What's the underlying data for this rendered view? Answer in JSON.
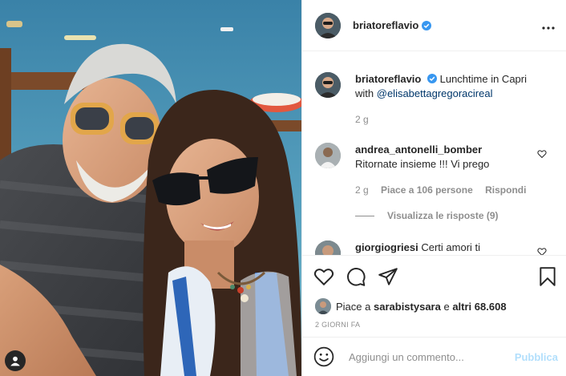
{
  "post": {
    "username": "briatoreflavio",
    "more_icon": "more-horizontal-icon",
    "caption_text": "Lunchtime in Capri",
    "caption_with": "with",
    "caption_mention": "@elisabettagregoracireal",
    "caption_age": "2 g"
  },
  "comments": [
    {
      "username": "andrea_antonelli_bomber",
      "text": "Ritornate insieme !!! Vi prego",
      "age": "2 g",
      "likes": "Piace a 106 persone",
      "reply": "Rispondi",
      "view_replies": "Visualizza le risposte (9)"
    },
    {
      "username": "giorgiogriesi",
      "text": "Certi amori ti"
    }
  ],
  "likes": {
    "prefix": "Piace a",
    "user": "sarabistysara",
    "middle": "e",
    "others": "altri 68.608"
  },
  "date": "2 GIORNI FA",
  "add_comment": {
    "placeholder": "Aggiungi un commento...",
    "publish": "Pubblica"
  },
  "colors": {
    "verified": "#3897f0",
    "link": "#00376b",
    "publish_disabled": "#b2dffc",
    "secondary_text": "#8e8e8e"
  }
}
